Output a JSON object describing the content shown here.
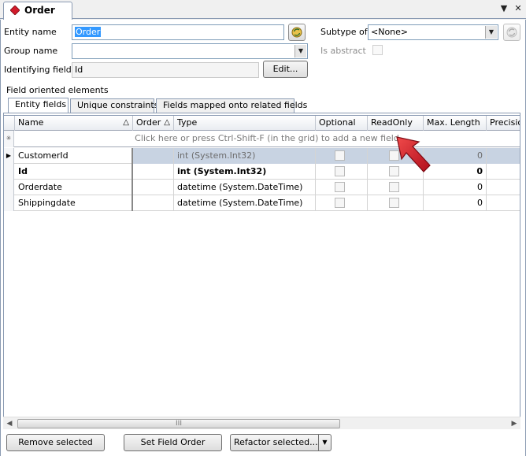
{
  "document": {
    "tab_label": "Order",
    "pin_glyph": "▼",
    "close_glyph": "✕"
  },
  "form": {
    "entity_name_label": "Entity name",
    "entity_name_value": "Order",
    "group_name_label": "Group name",
    "group_name_value": "",
    "identifying_fields_label": "Identifying fields",
    "identifying_fields_value": "Id",
    "edit_button": "Edit...",
    "subtype_of_label": "Subtype of",
    "subtype_of_value": "<None>",
    "is_abstract_label": "Is abstract",
    "is_abstract_checked": false
  },
  "section_label": "Field oriented elements",
  "tabs": [
    {
      "label": "Entity fields",
      "active": true
    },
    {
      "label": "Unique constraints",
      "active": false
    },
    {
      "label": "Fields mapped onto related fields",
      "active": false
    }
  ],
  "grid": {
    "columns": [
      "Name",
      "Order",
      "Type",
      "Optional",
      "ReadOnly",
      "Max. Length",
      "Precisio"
    ],
    "sort_glyph": "△",
    "new_row_marker": "✳",
    "new_row_hint": "Click here or press Ctrl-Shift-F (in the grid) to add a new field",
    "current_row_marker": "▶",
    "rows": [
      {
        "name": "CustomerId",
        "order": "",
        "type": "int (System.Int32)",
        "optional": false,
        "readonly": false,
        "max_length": "0",
        "precision": "",
        "bold": false,
        "selected": true
      },
      {
        "name": "Id",
        "order": "",
        "type": "int (System.Int32)",
        "optional": false,
        "readonly": false,
        "max_length": "0",
        "precision": "",
        "bold": true,
        "selected": false
      },
      {
        "name": "Orderdate",
        "order": "",
        "type": "datetime (System.DateTime)",
        "optional": false,
        "readonly": false,
        "max_length": "0",
        "precision": "",
        "bold": false,
        "selected": false
      },
      {
        "name": "Shippingdate",
        "order": "",
        "type": "datetime (System.DateTime)",
        "optional": false,
        "readonly": false,
        "max_length": "0",
        "precision": "",
        "bold": false,
        "selected": false
      }
    ]
  },
  "scrollbar": {
    "left_arrow": "◀",
    "right_arrow": "▶",
    "grip": "III"
  },
  "bottom_buttons": {
    "remove_selected": "Remove selected",
    "set_field_order": "Set Field Order",
    "refactor_selected": "Refactor selected...",
    "dropdown_glyph": "▼"
  },
  "colors": {
    "selection_blue": "#3399ff",
    "selected_row": "#c8d3e2",
    "arrow_red": "#d11a2a",
    "border": "#8a9ab2"
  }
}
